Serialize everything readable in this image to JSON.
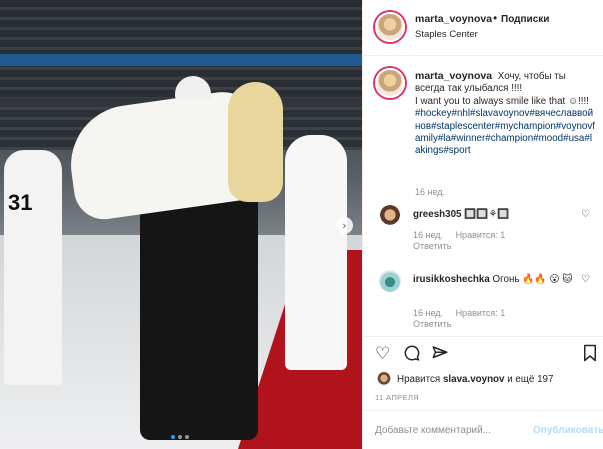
{
  "post": {
    "author": "marta_voynova",
    "follow_label": "Подписки",
    "location": "Staples Center",
    "caption_lines": [
      "Хочу, чтобы ты всегда так улыбался !!!!",
      "I want you to always smile like that ☺!!!!"
    ],
    "hashtags": "#hockey#nhl#slavavoynov#вячеславвойнов#staplescenter#mychampion#voynovfamily#la#winner#champion#mood#usa#lakings#sport",
    "time": "16 нед."
  },
  "comments": [
    {
      "user": "greesh305",
      "text": "🔲🔲⚘🔲",
      "time": "16 нед.",
      "likes": "Нравится: 1",
      "reply": "Ответить"
    },
    {
      "user": "irusikkoshechka",
      "text": "Огонь 🔥🔥 😮 🐱",
      "time": "16 нед.",
      "likes": "Нравится: 1",
      "reply": "Ответить"
    }
  ],
  "icons": {
    "like": "heart-icon",
    "comment": "comment-icon",
    "share": "share-icon",
    "save": "bookmark-icon",
    "next": "chevron-right-icon",
    "small_like": "heart-small-icon"
  },
  "likes": {
    "prefix": "Нравится ",
    "user": "slava.voynov",
    "suffix": " и ещё 197"
  },
  "date": "11 АПРЕЛЯ",
  "add_comment": {
    "placeholder": "Добавьте комментарий...",
    "publish": "Опубликовать"
  },
  "photo": {
    "jersey_number": "31",
    "slide_count": 3,
    "active_slide": 1
  },
  "colors": {
    "link": "#003569",
    "publish_disabled": "#b3dbff",
    "secondary_text": "#8e8e8e"
  }
}
